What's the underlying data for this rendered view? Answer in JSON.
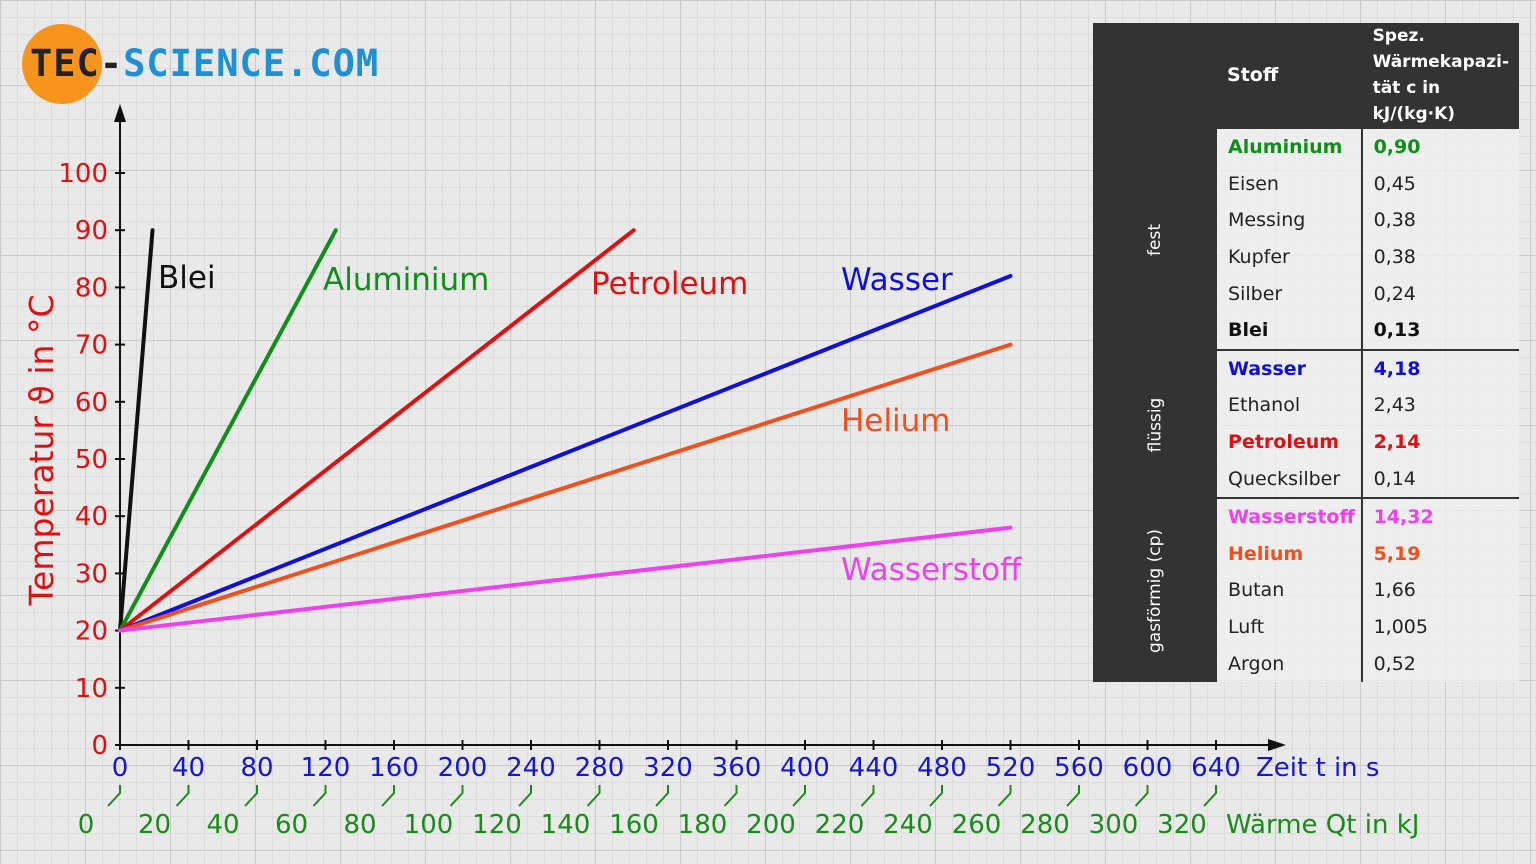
{
  "logo": {
    "part1": "TEC-",
    "part2": "SCIENCE.COM"
  },
  "chart_data": {
    "type": "line",
    "y_axis": {
      "label": "Temperatur ϑ in °C",
      "range": [
        0,
        100
      ],
      "ticks": [
        0,
        10,
        20,
        30,
        40,
        50,
        60,
        70,
        80,
        90,
        100
      ],
      "color": "#e01010"
    },
    "x_axis": {
      "label": "Zeit t in s",
      "range": [
        0,
        640
      ],
      "ticks": [
        0,
        40,
        80,
        120,
        160,
        200,
        240,
        280,
        320,
        360,
        400,
        440,
        480,
        520,
        560,
        600,
        640
      ],
      "color": "#1515d8"
    },
    "x2_axis": {
      "label": "Wärme Qt in kJ",
      "ticks": [
        0,
        20,
        40,
        60,
        80,
        100,
        120,
        140,
        160,
        180,
        200,
        220,
        240,
        260,
        280,
        300,
        320
      ],
      "color": "#1a8a1a"
    },
    "series": [
      {
        "name": "Blei",
        "color": "#111111",
        "points": [
          [
            0,
            20
          ],
          [
            19,
            90
          ]
        ]
      },
      {
        "name": "Aluminium",
        "color": "#0f8f1a",
        "points": [
          [
            0,
            20
          ],
          [
            126,
            90
          ]
        ]
      },
      {
        "name": "Petroleum",
        "color": "#e01010",
        "points": [
          [
            0,
            20
          ],
          [
            300,
            90
          ]
        ]
      },
      {
        "name": "Wasser",
        "color": "#1010dd",
        "points": [
          [
            0,
            20
          ],
          [
            520,
            82
          ]
        ]
      },
      {
        "name": "Helium",
        "color": "#f0501e",
        "points": [
          [
            0,
            20
          ],
          [
            520,
            70
          ]
        ]
      },
      {
        "name": "Wasserstoff",
        "color": "#ee40ee",
        "points": [
          [
            0,
            20
          ],
          [
            520,
            38
          ]
        ]
      }
    ]
  },
  "table": {
    "header": {
      "col1": "Stoff",
      "col2_line1": "Spez. Wärmekapazi-",
      "col2_line2": "tät c in kJ/(kg·K)"
    },
    "groups": [
      {
        "label": "fest",
        "rows": [
          {
            "name": "Aluminium",
            "value": "0,90",
            "color": "#0f8f1a"
          },
          {
            "name": "Eisen",
            "value": "0,45",
            "color": ""
          },
          {
            "name": "Messing",
            "value": "0,38",
            "color": ""
          },
          {
            "name": "Kupfer",
            "value": "0,38",
            "color": ""
          },
          {
            "name": "Silber",
            "value": "0,24",
            "color": ""
          },
          {
            "name": "Blei",
            "value": "0,13",
            "color": "#111111"
          }
        ]
      },
      {
        "label": "flüssig",
        "rows": [
          {
            "name": "Wasser",
            "value": "4,18",
            "color": "#1010dd"
          },
          {
            "name": "Ethanol",
            "value": "2,43",
            "color": ""
          },
          {
            "name": "Petroleum",
            "value": "2,14",
            "color": "#e01010"
          },
          {
            "name": "Quecksilber",
            "value": "0,14",
            "color": ""
          }
        ]
      },
      {
        "label": "gasförmig (cp)",
        "rows": [
          {
            "name": "Wasserstoff",
            "value": "14,32",
            "color": "#ee40ee"
          },
          {
            "name": "Helium",
            "value": "5,19",
            "color": "#f0501e"
          },
          {
            "name": "Butan",
            "value": "1,66",
            "color": ""
          },
          {
            "name": "Luft",
            "value": "1,005",
            "color": ""
          },
          {
            "name": "Argon",
            "value": "0,52",
            "color": ""
          }
        ]
      }
    ]
  }
}
